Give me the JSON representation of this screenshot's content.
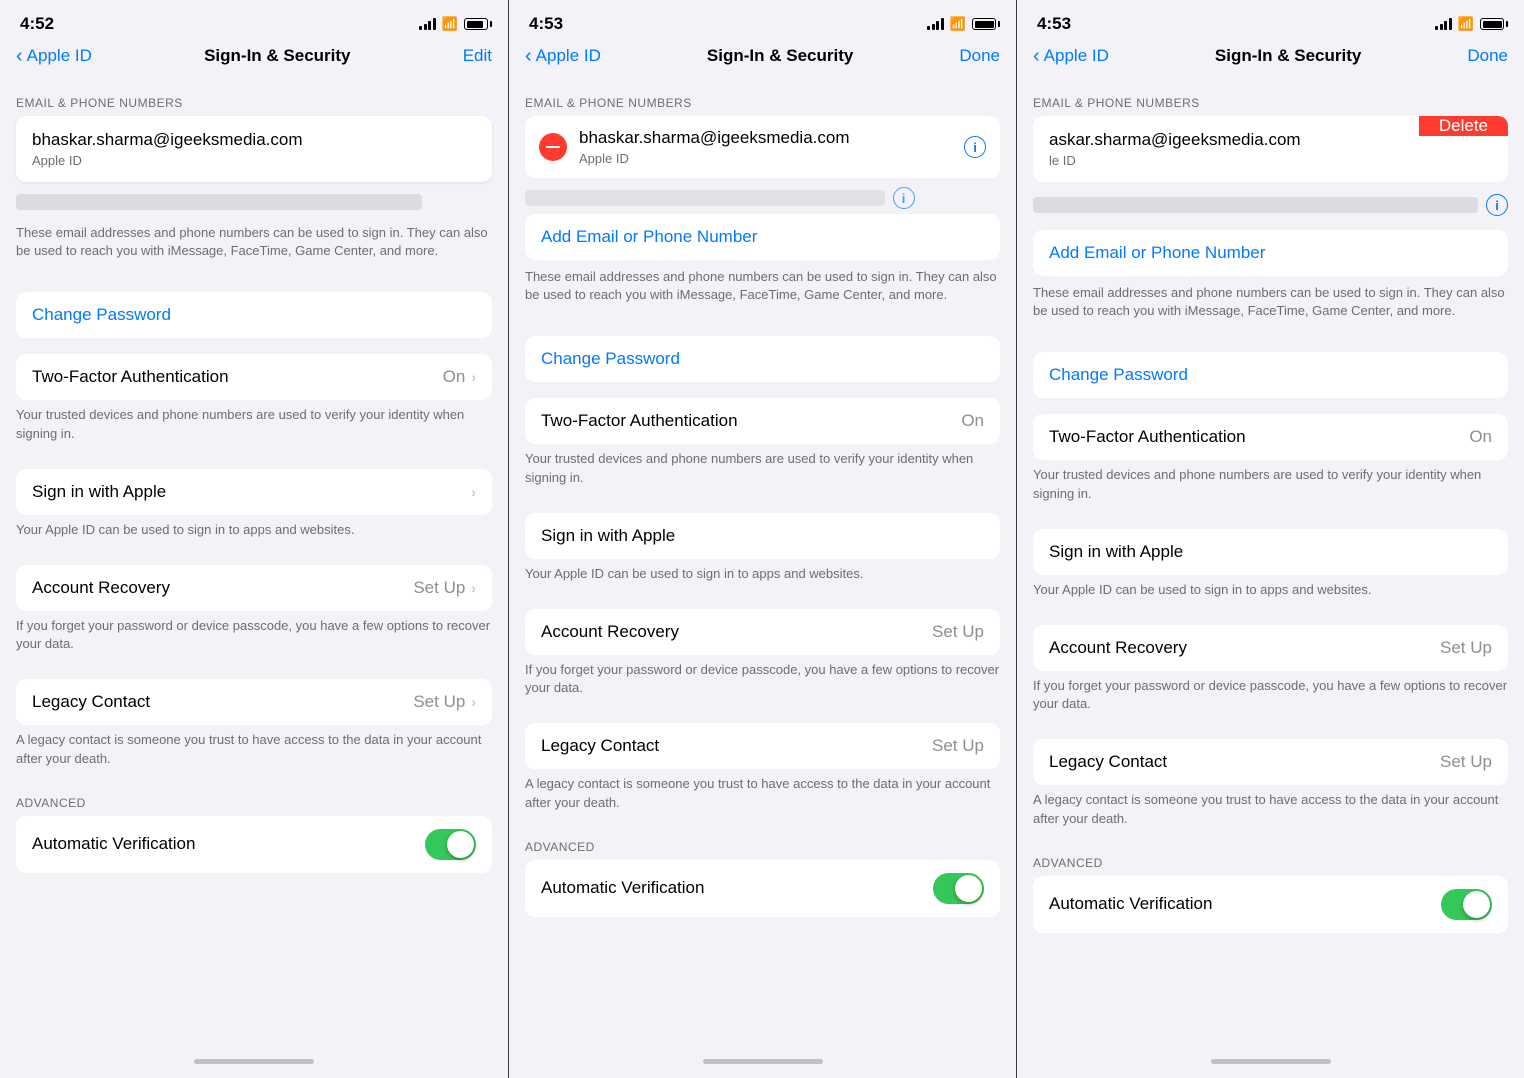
{
  "panels": [
    {
      "id": "panel1",
      "statusBar": {
        "time": "4:52",
        "batteryFull": false
      },
      "nav": {
        "backLabel": "Apple ID",
        "title": "Sign-In & Security",
        "actionLabel": "Edit"
      },
      "sectionHeader": "EMAIL & PHONE NUMBERS",
      "emailCard": {
        "address": "bhaskar.sharma@igeeksmedia.com",
        "label": "Apple ID"
      },
      "showDeleteMinus": false,
      "showDeleteBtn": false,
      "blurredRows": true,
      "addEmailLink": null,
      "changePasswordLabel": "Change Password",
      "twoFactorLabel": "Two-Factor Authentication",
      "twoFactorValue": "On",
      "twoFactorDesc": "Your trusted devices and phone numbers are used to verify your identity when signing in.",
      "signInWithAppleLabel": "Sign in with Apple",
      "signInWithAppleDesc": "Your Apple ID can be used to sign in to apps and websites.",
      "accountRecoveryLabel": "Account Recovery",
      "accountRecoveryValue": "Set Up",
      "accountRecoveryDesc": "If you forget your password or device passcode, you have a few options to recover your data.",
      "legacyContactLabel": "Legacy Contact",
      "legacyContactValue": "Set Up",
      "legacyContactDesc": "A legacy contact is someone you trust to have access to the data in your account after your death.",
      "advancedHeader": "ADVANCED",
      "autoVerificationLabel": "Automatic Verification",
      "autoVerificationOn": true,
      "showChevrons": true,
      "infoDesc": "These email addresses and phone numbers can be used to sign in. They can also be used to reach you with iMessage, FaceTime, Game Center, and more."
    },
    {
      "id": "panel2",
      "statusBar": {
        "time": "4:53",
        "batteryFull": true
      },
      "nav": {
        "backLabel": "Apple ID",
        "title": "Sign-In & Security",
        "actionLabel": "Done"
      },
      "sectionHeader": "EMAIL & PHONE NUMBERS",
      "emailCard": {
        "address": "bhaskar.sharma@igeeksmedia.com",
        "label": "Apple ID"
      },
      "showDeleteMinus": true,
      "showDeleteBtn": false,
      "blurredRows": true,
      "addEmailLink": "Add Email or Phone Number",
      "changePasswordLabel": "Change Password",
      "twoFactorLabel": "Two-Factor Authentication",
      "twoFactorValue": "On",
      "twoFactorDesc": "Your trusted devices and phone numbers are used to verify your identity when signing in.",
      "signInWithAppleLabel": "Sign in with Apple",
      "signInWithAppleDesc": "Your Apple ID can be used to sign in to apps and websites.",
      "accountRecoveryLabel": "Account Recovery",
      "accountRecoveryValue": "Set Up",
      "accountRecoveryDesc": "If you forget your password or device passcode, you have a few options to recover your data.",
      "legacyContactLabel": "Legacy Contact",
      "legacyContactValue": "Set Up",
      "legacyContactDesc": "A legacy contact is someone you trust to have access to the data in your account after your death.",
      "advancedHeader": "ADVANCED",
      "autoVerificationLabel": "Automatic Verification",
      "autoVerificationOn": true,
      "showChevrons": false,
      "infoDesc": "These email addresses and phone numbers can be used to sign in. They can also be used to reach you with iMessage, FaceTime, Game Center, and more."
    },
    {
      "id": "panel3",
      "statusBar": {
        "time": "4:53",
        "batteryFull": true
      },
      "nav": {
        "backLabel": "Apple ID",
        "title": "Sign-In & Security",
        "actionLabel": "Done"
      },
      "sectionHeader": "EMAIL & PHONE NUMBERS",
      "emailCard": {
        "address": "askar.sharma@igeeksmedia.com",
        "label": "le ID"
      },
      "showDeleteMinus": false,
      "showDeleteBtn": true,
      "deleteLabel": "Delete",
      "blurredRows": true,
      "addEmailLink": "Add Email or Phone Number",
      "changePasswordLabel": "Change Password",
      "twoFactorLabel": "Two-Factor Authentication",
      "twoFactorValue": "On",
      "twoFactorDesc": "Your trusted devices and phone numbers are used to verify your identity when signing in.",
      "signInWithAppleLabel": "Sign in with Apple",
      "signInWithAppleDesc": "Your Apple ID can be used to sign in to apps and websites.",
      "accountRecoveryLabel": "Account Recovery",
      "accountRecoveryValue": "Set Up",
      "accountRecoveryDesc": "If you forget your password or device passcode, you have a few options to recover your data.",
      "legacyContactLabel": "Legacy Contact",
      "legacyContactValue": "Set Up",
      "legacyContactDesc": "A legacy contact is someone you trust to have access to the data in your account after your death.",
      "advancedHeader": "ADVANCED",
      "autoVerificationLabel": "Automatic Verification",
      "autoVerificationOn": true,
      "showChevrons": false,
      "infoDesc": "These email addresses and phone numbers can be used to sign in. They can also be used to reach you with iMessage, FaceTime, Game Center, and more."
    }
  ]
}
